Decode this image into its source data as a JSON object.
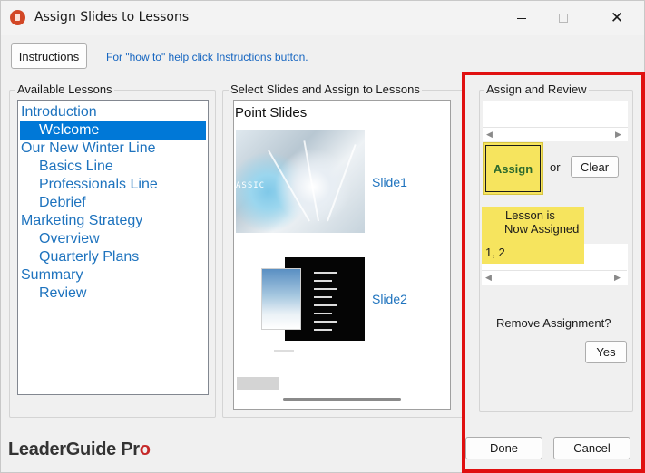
{
  "window": {
    "title": "Assign Slides to Lessons",
    "close_glyph": "✕"
  },
  "toolbar": {
    "instructions_label": "Instructions",
    "help_text": "For \"how to\" help click Instructions button."
  },
  "lessons": {
    "group_label": "Available Lessons",
    "items": [
      {
        "label": "Introduction",
        "level": 0,
        "selected": false
      },
      {
        "label": "Welcome",
        "level": 1,
        "selected": true
      },
      {
        "label": "Our New Winter Line",
        "level": 0,
        "selected": false
      },
      {
        "label": "Basics Line",
        "level": 1,
        "selected": false
      },
      {
        "label": "Professionals Line",
        "level": 1,
        "selected": false
      },
      {
        "label": "Debrief",
        "level": 1,
        "selected": false
      },
      {
        "label": "Marketing Strategy",
        "level": 0,
        "selected": false
      },
      {
        "label": "Overview",
        "level": 1,
        "selected": false
      },
      {
        "label": "Quarterly Plans",
        "level": 1,
        "selected": false
      },
      {
        "label": "Summary",
        "level": 0,
        "selected": false
      },
      {
        "label": "Review",
        "level": 1,
        "selected": false
      }
    ]
  },
  "slides": {
    "group_label": "Select Slides and Assign to Lessons",
    "panel_title": "Point Slides",
    "thumb1_word": "ASSIC",
    "items": [
      {
        "caption": "Slide1"
      },
      {
        "caption": "Slide2"
      }
    ]
  },
  "review": {
    "group_label": "Assign and Review",
    "assign_label": "Assign",
    "or_text": "or",
    "clear_label": "Clear",
    "assigned_note_line1": "Lesson is",
    "assigned_note_line2": "Now Assigned",
    "assigned_values": "1, 2",
    "remove_label": "Remove Assignment?",
    "yes_label": "Yes"
  },
  "footer": {
    "logo_main": "LeaderGuide Pr",
    "logo_accent": "o",
    "done_label": "Done",
    "cancel_label": "Cancel"
  },
  "colors": {
    "accent_link": "#1e73be",
    "selected_bg": "#0078d7",
    "highlight_yellow": "#f6e45e",
    "callout_red": "#e01010"
  }
}
